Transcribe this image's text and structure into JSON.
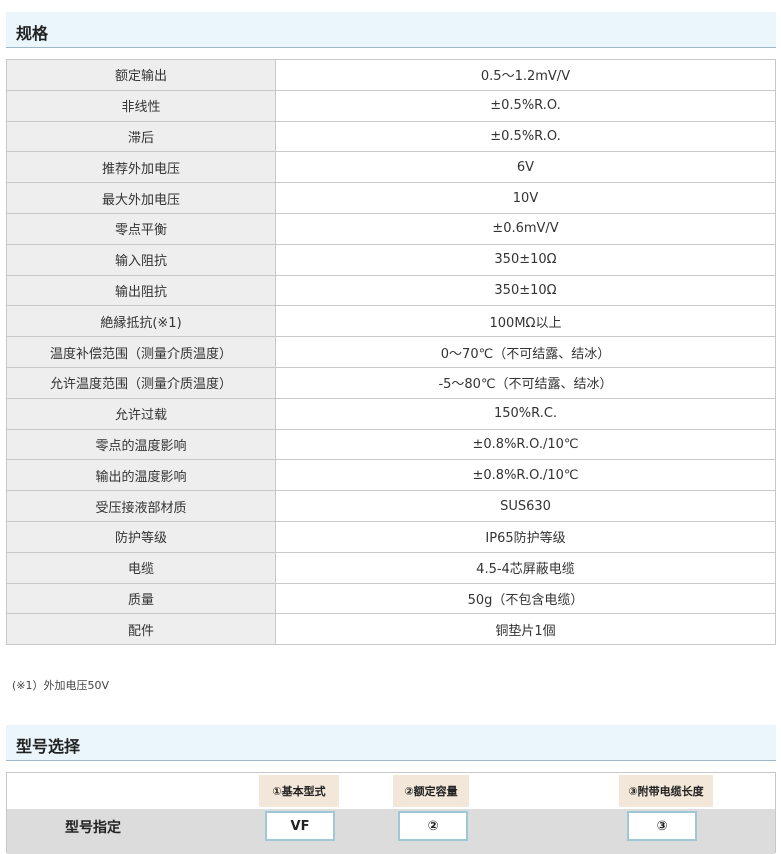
{
  "spec_section": {
    "title": "规格",
    "rows": [
      {
        "label": "额定输出",
        "value": "0.5～1.2mV/V"
      },
      {
        "label": "非线性",
        "value": "±0.5%R.O."
      },
      {
        "label": "滞后",
        "value": "±0.5%R.O."
      },
      {
        "label": "推荐外加电压",
        "value": "6V"
      },
      {
        "label": "最大外加电压",
        "value": "10V"
      },
      {
        "label": "零点平衡",
        "value": "±0.6mV/V"
      },
      {
        "label": "输入阻抗",
        "value": "350±10Ω"
      },
      {
        "label": "输出阻抗",
        "value": "350±10Ω"
      },
      {
        "label": "絶縁抵抗(※1)",
        "value": "100MΩ以上"
      },
      {
        "label": "温度补偿范围（测量介质温度）",
        "value": "0～70℃（不可结露、结冰）"
      },
      {
        "label": "允许温度范围（测量介质温度）",
        "value": "-5～80℃（不可结露、结冰）"
      },
      {
        "label": "允许过载",
        "value": "150%R.C."
      },
      {
        "label": "零点的温度影响",
        "value": "±0.8%R.O./10℃"
      },
      {
        "label": "输出的温度影响",
        "value": "±0.8%R.O./10℃"
      },
      {
        "label": "受压接液部材质",
        "value": "SUS630"
      },
      {
        "label": "防护等级",
        "value": "IP65防护等级"
      },
      {
        "label": "电缆",
        "value": "4.5-4芯屏蔽电缆"
      },
      {
        "label": "质量",
        "value": "50g（不包含电缆）"
      },
      {
        "label": "配件",
        "value": "铜垫片1個"
      }
    ],
    "footnote": "(※1）外加电压50V"
  },
  "model_section": {
    "title": "型号选择",
    "row_label": "型号指定",
    "columns": [
      {
        "heading": "①基本型式",
        "code": "VF"
      },
      {
        "heading": "②额定容量",
        "code": "②"
      },
      {
        "heading": "③附带电缆长度",
        "code": "③"
      }
    ]
  }
}
